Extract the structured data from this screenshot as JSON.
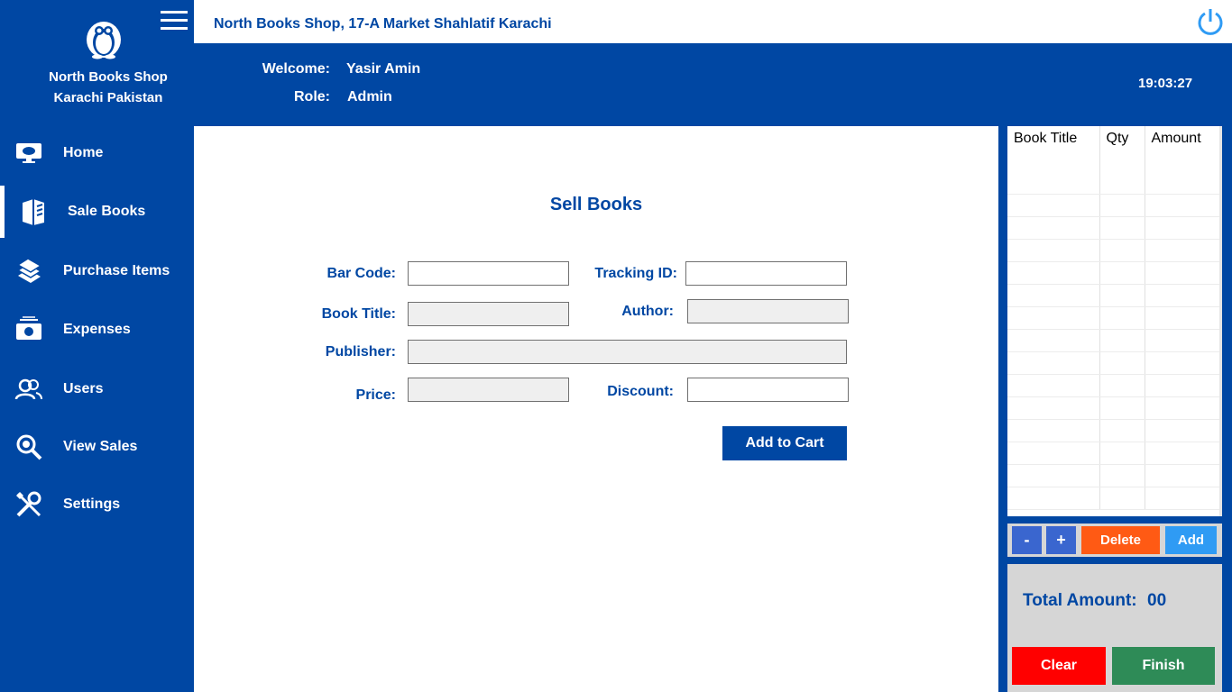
{
  "sidebar": {
    "shop_name": "North Books Shop",
    "shop_city": "Karachi Pakistan",
    "items": [
      {
        "label": "Home",
        "icon": "monitor-icon"
      },
      {
        "label": "Sale Books",
        "icon": "books-sale-icon"
      },
      {
        "label": "Purchase Items",
        "icon": "book-stack-icon"
      },
      {
        "label": "Expenses",
        "icon": "money-icon"
      },
      {
        "label": "Users",
        "icon": "users-icon"
      },
      {
        "label": "View Sales",
        "icon": "magnifier-icon"
      },
      {
        "label": "Settings",
        "icon": "tools-icon"
      }
    ],
    "active_item": "Sale Books"
  },
  "topbar": {
    "address": "North Books Shop, 17-A Market Shahlatif Karachi",
    "power_icon": "power-icon"
  },
  "header": {
    "welcome_label": "Welcome:",
    "welcome_value": "Yasir Amin",
    "role_label": "Role:",
    "role_value": "Admin",
    "clock": "19:03:27"
  },
  "form": {
    "title": "Sell Books",
    "bar_code_label": "Bar Code:",
    "bar_code_value": "",
    "tracking_id_label": "Tracking ID:",
    "tracking_id_value": "",
    "book_title_label": "Book Title:",
    "book_title_value": "",
    "author_label": "Author:",
    "author_value": "",
    "publisher_label": "Publisher:",
    "publisher_value": "",
    "price_label": "Price:",
    "price_value": "",
    "discount_label": "Discount:",
    "discount_value": "",
    "add_to_cart_label": "Add to Cart"
  },
  "cart": {
    "columns": [
      "Book Title",
      "Qty",
      "Amount"
    ],
    "rows": [],
    "minus_label": "-",
    "plus_label": "+",
    "delete_label": "Delete",
    "add_label": "Add"
  },
  "total": {
    "label": "Total Amount:",
    "value": "00",
    "clear_label": "Clear",
    "finish_label": "Finish"
  },
  "colors": {
    "brand": "#0047a3",
    "delete": "#ff5a14",
    "add": "#2f9bf4",
    "clear": "#ff0000",
    "finish": "#2e8b57"
  }
}
